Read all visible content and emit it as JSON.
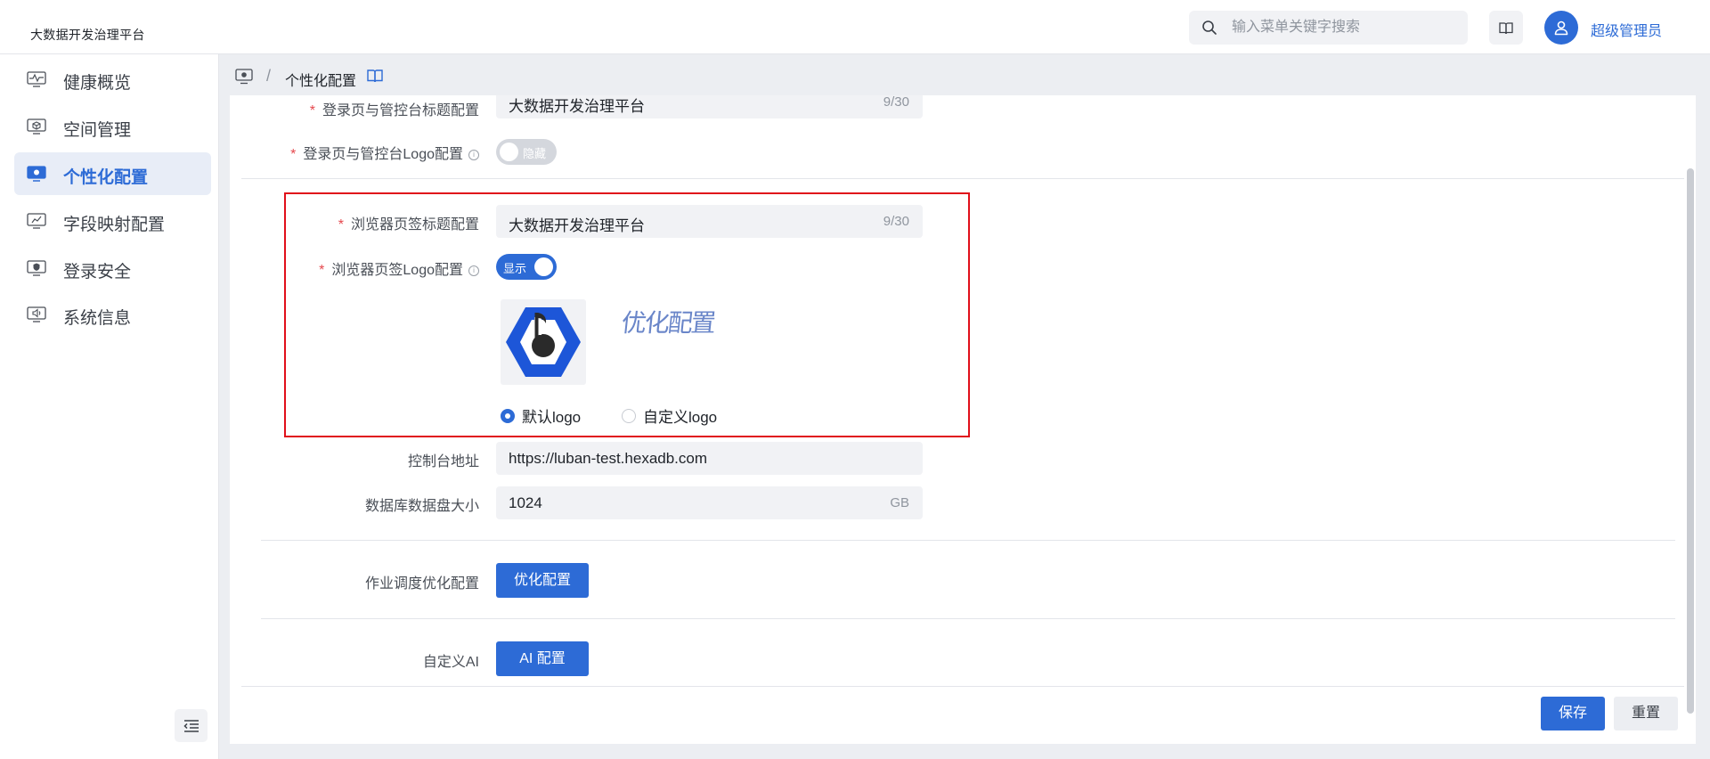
{
  "app": {
    "title": "大数据开发治理平台"
  },
  "header": {
    "search_placeholder": "输入菜单关键字搜索",
    "user_name": "超级管理员",
    "icons": {
      "search": "search-icon",
      "docs": "book-icon",
      "user": "user-icon"
    }
  },
  "sidebar": {
    "items": [
      {
        "label": "健康概览",
        "icon": "heartbeat-monitor-icon",
        "active": false
      },
      {
        "label": "空间管理",
        "icon": "cube-monitor-icon",
        "active": false
      },
      {
        "label": "个性化配置",
        "icon": "settings-monitor-icon",
        "active": true
      },
      {
        "label": "字段映射配置",
        "icon": "chart-monitor-icon",
        "active": false
      },
      {
        "label": "登录安全",
        "icon": "shield-monitor-icon",
        "active": false
      },
      {
        "label": "系统信息",
        "icon": "speaker-monitor-icon",
        "active": false
      }
    ],
    "collapse_icon": "collapse-menu-icon"
  },
  "breadcrumb": {
    "current": "个性化配置",
    "separator": "/"
  },
  "form": {
    "login_title": {
      "label": "登录页与管控台标题配置",
      "value": "大数据开发治理平台",
      "count": "9/30",
      "required": true
    },
    "login_logo": {
      "label": "登录页与管控台Logo配置",
      "toggle_text": "隐藏",
      "enabled": false,
      "required": true
    },
    "browser_title": {
      "label": "浏览器页签标题配置",
      "value": "大数据开发治理平台",
      "count": "9/30",
      "required": true
    },
    "browser_logo": {
      "label": "浏览器页签Logo配置",
      "toggle_text": "显示",
      "enabled": true,
      "required": true,
      "preview_text": "优化配置",
      "options": [
        {
          "label": "默认logo",
          "checked": true
        },
        {
          "label": "自定义logo",
          "checked": false
        }
      ]
    },
    "console_url": {
      "label": "控制台地址",
      "value": "https://luban-test.hexadb.com"
    },
    "disk_size": {
      "label": "数据库数据盘大小",
      "value": "1024",
      "unit": "GB"
    },
    "job_optimize": {
      "label": "作业调度优化配置",
      "button": "优化配置"
    },
    "custom_ai": {
      "label": "自定义AI",
      "button": "AI 配置"
    }
  },
  "footer": {
    "save": "保存",
    "reset": "重置"
  },
  "colors": {
    "primary": "#2d6bd6",
    "highlight": "#e0101a",
    "required": "#e5484d"
  }
}
